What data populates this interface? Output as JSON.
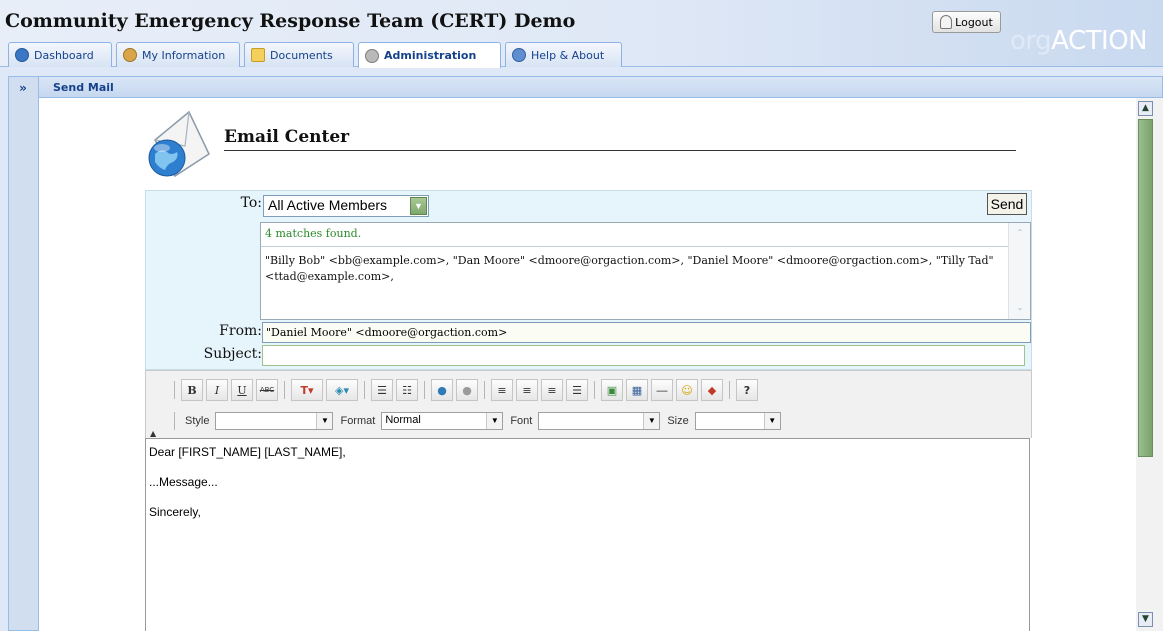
{
  "app": {
    "title": "Community Emergency Response Team (CERT) Demo",
    "logout_label": "Logout",
    "brand_prefix": "org",
    "brand_suffix": "ACTION"
  },
  "tabs": [
    {
      "label": "Dashboard",
      "icon": "info-icon",
      "active": false
    },
    {
      "label": "My Information",
      "icon": "user-icon",
      "active": false
    },
    {
      "label": "Documents",
      "icon": "folder-icon",
      "active": false
    },
    {
      "label": "Administration",
      "icon": "gear-icon",
      "active": true
    },
    {
      "label": "Help & About",
      "icon": "help-icon",
      "active": false
    }
  ],
  "sidebar": {
    "expand_label": "»"
  },
  "panel": {
    "title": "Send Mail"
  },
  "email_center": {
    "title": "Email Center",
    "to_label": "To:",
    "to_value": "All Active Members",
    "send_label": "Send",
    "matches_count": "4 matches found.",
    "matches_text": "\"Billy Bob\" <bb@example.com>, \"Dan Moore\" <dmoore@orgaction.com>, \"Daniel Moore\" <dmoore@orgaction.com>, \"Tilly Tad\" <ttad@example.com>,",
    "from_label": "From:",
    "from_value": "\"Daniel Moore\" <dmoore@orgaction.com>",
    "subject_label": "Subject:",
    "subject_value": ""
  },
  "toolbar": {
    "bold": "B",
    "italic": "I",
    "underline": "U",
    "strike": "ABC",
    "style_label": "Style",
    "style_value": "",
    "format_label": "Format",
    "format_value": "Normal",
    "font_label": "Font",
    "font_value": "",
    "size_label": "Size",
    "size_value": ""
  },
  "editor": {
    "line1": "Dear [FIRST_NAME] [LAST_NAME],",
    "line2": "...Message...",
    "line3": "Sincerely,"
  },
  "colors": {
    "accent": "#15428b",
    "panel_bg": "#dfe8f6",
    "form_bg": "#e6f4fb",
    "matches_green": "#2c8a2c",
    "scroll_thumb": "#8ab07b"
  }
}
